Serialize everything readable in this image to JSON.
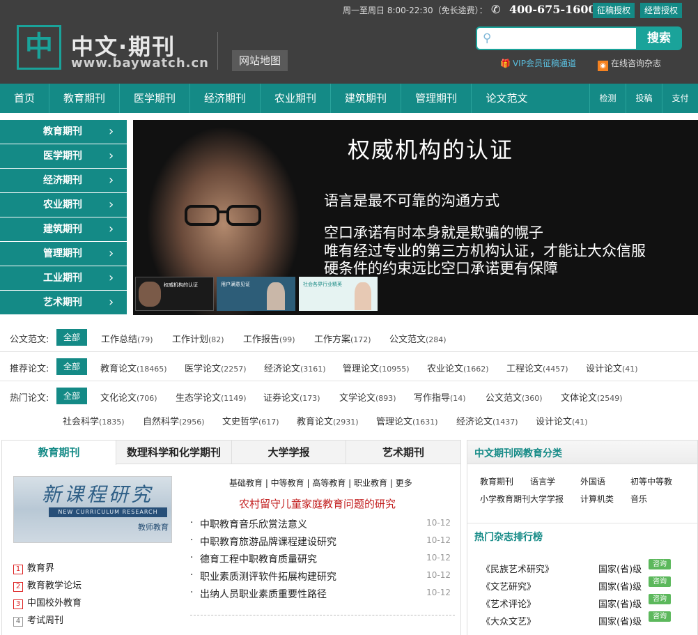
{
  "header": {
    "logo_glyph": "中",
    "logo_title": "中文·期刊",
    "logo_url": "www.baywatch.cn",
    "sitemap": "网站地图",
    "hours": "周一至周日 8:00-22:30（免长途费）：",
    "phone": "400-675-1600",
    "btn_copyright": "征稿授权",
    "btn_business": "经营授权",
    "search_placeholder": "",
    "search_button": "搜索",
    "vip_link": "VIP会员征稿通道",
    "consult_link": "在线咨询杂志",
    "icons": [
      "logo-icon",
      "phone-icon",
      "search-icon",
      "gift-icon",
      "rss-icon"
    ]
  },
  "nav": {
    "items": [
      "首页",
      "教育期刊",
      "医学期刊",
      "经济期刊",
      "农业期刊",
      "建筑期刊",
      "管理期刊",
      "论文范文"
    ],
    "small": [
      "检测",
      "投稿",
      "支付"
    ]
  },
  "sidebar": {
    "items": [
      "教育期刊",
      "医学期刊",
      "经济期刊",
      "农业期刊",
      "建筑期刊",
      "管理期刊",
      "工业期刊",
      "艺术期刊"
    ]
  },
  "banner": {
    "heading": "权威机构的认证",
    "lines": [
      "语言是最不可靠的沟通方式",
      "空口承诺有时本身就是欺骗的幌子",
      "唯有经过专业的第三方机构认证，才能让大众信服",
      "硬条件的约束远比空口承诺更有保障"
    ],
    "thumbs": [
      "权威机构的认证",
      "用户满意见证",
      "社会各界行业精英"
    ]
  },
  "filters": {
    "all_label": "全部",
    "rows": [
      {
        "label": "公文范文:",
        "items": [
          {
            "name": "工作总结",
            "count": "(79)"
          },
          {
            "name": "工作计划",
            "count": "(82)"
          },
          {
            "name": "工作报告",
            "count": "(99)"
          },
          {
            "name": "工作方案",
            "count": "(172)"
          },
          {
            "name": "公文范文",
            "count": "(284)"
          }
        ]
      },
      {
        "label": "推荐论文:",
        "items": [
          {
            "name": "教育论文",
            "count": "(18465)"
          },
          {
            "name": "医学论文",
            "count": "(2257)"
          },
          {
            "name": "经济论文",
            "count": "(3161)"
          },
          {
            "name": "管理论文",
            "count": "(10955)"
          },
          {
            "name": "农业论文",
            "count": "(1662)"
          },
          {
            "name": "工程论文",
            "count": "(4457)"
          },
          {
            "name": "设计论文",
            "count": "(41)"
          }
        ]
      },
      {
        "label": "热门论文:",
        "items": [
          {
            "name": "文化论文",
            "count": "(706)"
          },
          {
            "name": "生态学论文",
            "count": "(1149)"
          },
          {
            "name": "证券论文",
            "count": "(173)"
          },
          {
            "name": "文学论文",
            "count": "(893)"
          },
          {
            "name": "写作指导",
            "count": "(14)"
          },
          {
            "name": "公文范文",
            "count": "(360)"
          },
          {
            "name": "文体论文",
            "count": "(2549)"
          }
        ]
      }
    ],
    "row4": [
      {
        "name": "社会科学",
        "count": "(1835)"
      },
      {
        "name": "自然科学",
        "count": "(2956)"
      },
      {
        "name": "文史哲学",
        "count": "(617)"
      },
      {
        "name": "教育论文",
        "count": "(2931)"
      },
      {
        "name": "管理论文",
        "count": "(1631)"
      },
      {
        "name": "经济论文",
        "count": "(1437)"
      },
      {
        "name": "设计论文",
        "count": "(41)"
      }
    ]
  },
  "panel": {
    "tabs": [
      "教育期刊",
      "数理科学和化学期刊",
      "大学学报",
      "艺术期刊"
    ],
    "magazine": {
      "title": "新课程研究",
      "band": "NEW CURRICULUM RESEARCH",
      "sub": "教师教育"
    },
    "ranked": [
      "教育界",
      "教育教学论坛",
      "中国校外教育",
      "考试周刊"
    ],
    "sublinks": "基础教育 | 中等教育 | 高等教育 | 职业教育 | 更多",
    "headline": "农村留守儿童家庭教育问题的研究",
    "articles": [
      {
        "title": "中职教育音乐欣赏法意义",
        "date": "10-12"
      },
      {
        "title": "中职教育旅游品牌课程建设研究",
        "date": "10-12"
      },
      {
        "title": "德育工程中职教育质量研究",
        "date": "10-12"
      },
      {
        "title": "职业素质测评软件拓展构建研究",
        "date": "10-12"
      },
      {
        "title": "出纳人员职业素质重要性路径",
        "date": "10-12"
      }
    ]
  },
  "right": {
    "title": "中文期刊网教育分类",
    "cats": [
      "教育期刊",
      "语言学",
      "外国语",
      "初等中等教",
      "小学教育期刊",
      "大学学报",
      "计算机类",
      "音乐"
    ],
    "rank_title": "热门杂志排行榜",
    "rank": [
      {
        "name": "《民族艺术研究》",
        "level": "国家(省)级"
      },
      {
        "name": "《文艺研究》",
        "level": "国家(省)级"
      },
      {
        "name": "《艺术评论》",
        "level": "国家(省)级"
      },
      {
        "name": "《大众文艺》",
        "level": "国家(省)级"
      }
    ],
    "consult": "咨询"
  }
}
